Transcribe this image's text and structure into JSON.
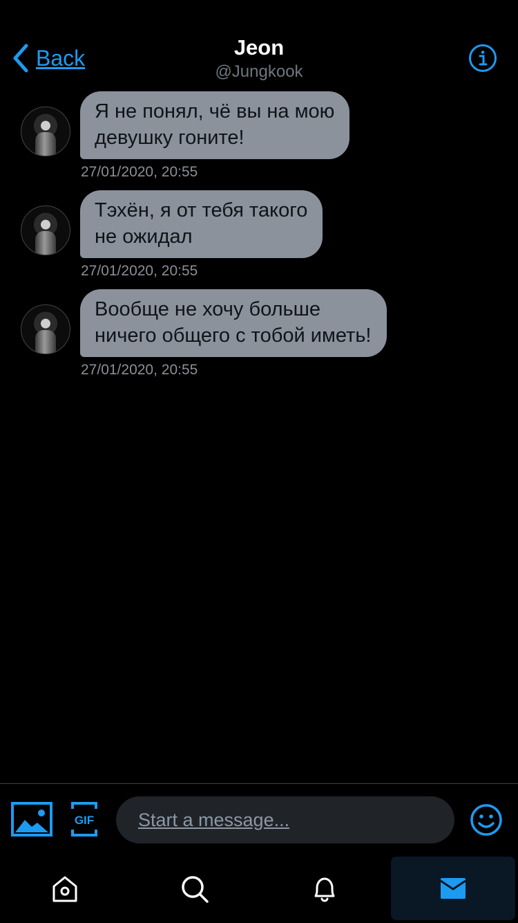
{
  "header": {
    "back_label": "Back",
    "contact_name": "Jeon",
    "contact_handle": "@Jungkook"
  },
  "messages": [
    {
      "text": "Я не понял, чё вы на мою\nдевушку гоните!",
      "timestamp": "27/01/2020, 20:55"
    },
    {
      "text": "Тэхён, я от тебя такого\nне ожидал",
      "timestamp": "27/01/2020, 20:55"
    },
    {
      "text": "Вообще не хочу больше\nничего общего с тобой иметь!",
      "timestamp": "27/01/2020, 20:55"
    }
  ],
  "composer": {
    "placeholder": "Start a message...",
    "gif_label": "GIF"
  },
  "tabbar": {
    "items": [
      "home",
      "search",
      "notifications",
      "messages"
    ],
    "active": "messages"
  },
  "colors": {
    "accent": "#1d9bf0",
    "bubble": "#8b929c",
    "background": "#000000",
    "timestamp": "#8a8f95"
  },
  "icons": [
    "chevron-left-icon",
    "info-icon",
    "image-icon",
    "gif-icon",
    "emoji-icon",
    "home-icon",
    "search-icon",
    "bell-icon",
    "mail-icon"
  ]
}
